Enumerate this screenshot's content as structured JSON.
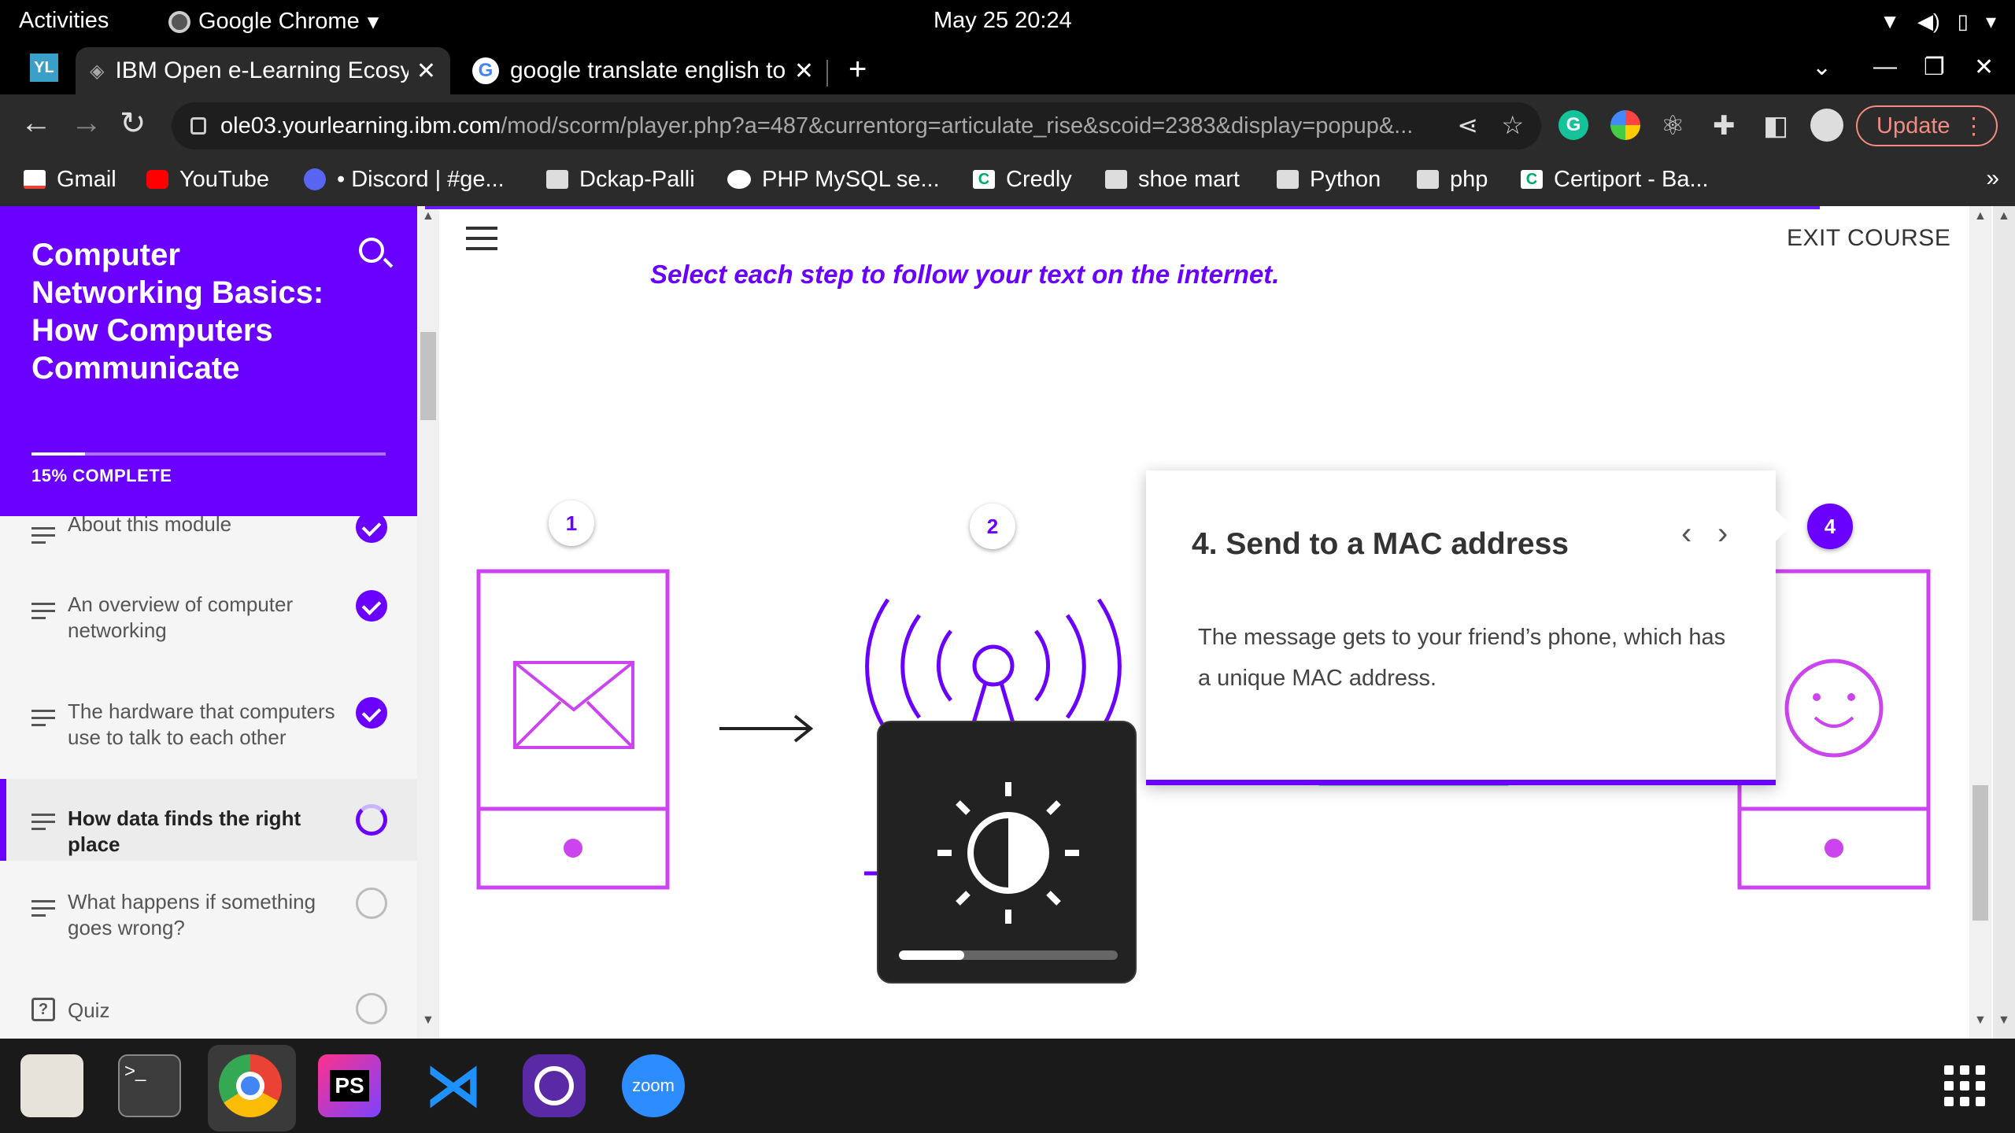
{
  "system_bar": {
    "activities": "Activities",
    "app_name": "Google Chrome",
    "clock": "May 25  20:24"
  },
  "tabs": [
    {
      "title": "IBM Open e-Learning Ecosystem",
      "active": true
    },
    {
      "title": "google translate english to",
      "active": false
    }
  ],
  "address_bar": {
    "domain": "ole03.yourlearning.ibm.com",
    "path": "/mod/scorm/player.php?a=487&currentorg=articulate_rise&scoid=2383&display=popup&..."
  },
  "update_button": "Update",
  "bookmarks": [
    {
      "label": "Gmail",
      "icon": "gmail-icon"
    },
    {
      "label": "YouTube",
      "icon": "youtube-icon"
    },
    {
      "label": "• Discord | #ge...",
      "icon": "discord-icon"
    },
    {
      "label": "Dckap-Palli",
      "icon": "folder-icon"
    },
    {
      "label": "PHP MySQL se...",
      "icon": "medium-icon"
    },
    {
      "label": "Credly",
      "icon": "credly-icon"
    },
    {
      "label": "shoe mart",
      "icon": "folder-icon"
    },
    {
      "label": "Python",
      "icon": "folder-icon"
    },
    {
      "label": "php",
      "icon": "folder-icon"
    },
    {
      "label": "Certiport - Ba...",
      "icon": "credly-icon"
    }
  ],
  "bookmarks_more": "»",
  "course": {
    "title": "Computer Networking Basics: How Computers Communicate",
    "progress_percent": 15,
    "progress_label": "15% COMPLETE",
    "lessons": [
      {
        "title": "About this module",
        "status": "complete"
      },
      {
        "title": "An overview of computer networking",
        "status": "complete"
      },
      {
        "title": "The hardware that computers use to talk to each other",
        "status": "complete"
      },
      {
        "title": "How data finds the right place",
        "status": "in-progress"
      },
      {
        "title": "What happens if something goes wrong?",
        "status": "not-started"
      },
      {
        "title": "Quiz",
        "status": "not-started"
      }
    ]
  },
  "main": {
    "exit_label": "EXIT COURSE",
    "instruction": "Select each step to follow your text on the internet.",
    "steps": [
      "1",
      "2",
      "4"
    ],
    "active_step": "4",
    "popup": {
      "title": "4. Send to a MAC address",
      "body": "The message gets to your friend’s phone, which has a unique MAC address.",
      "prev": "‹",
      "next": "›"
    }
  },
  "osd": {
    "brightness": 0.3
  },
  "colors": {
    "accent": "#6a00ff",
    "phone_outline": "#cc44ee",
    "router": "#00cc66"
  },
  "dock": [
    "files-icon",
    "terminal-icon",
    "chrome-icon",
    "phpstorm-icon",
    "vscode-icon",
    "screen-recorder-icon",
    "zoom-icon"
  ],
  "dock_labels": {
    "phpstorm": "PS",
    "zoom": "zoom"
  }
}
